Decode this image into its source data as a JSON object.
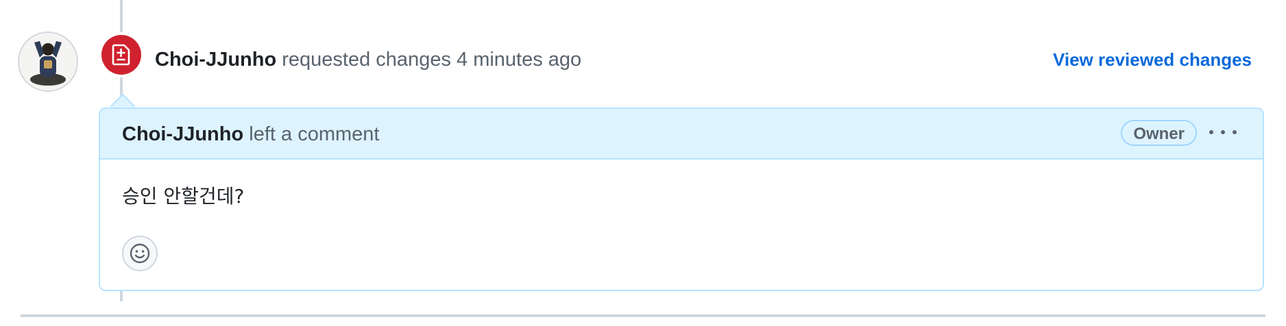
{
  "review_event": {
    "author": "Choi-JJunho",
    "action": "requested changes",
    "time": "4 minutes ago",
    "view_changes_label": "View reviewed changes",
    "badge_icon": "file-diff-icon",
    "badge_color": "#cf222e"
  },
  "comment": {
    "author": "Choi-JJunho",
    "action": "left a comment",
    "role_badge": "Owner",
    "menu_icon": "kebab-horizontal-icon",
    "body": "승인 안할건데?",
    "reaction_icon": "smiley-icon"
  },
  "colors": {
    "link": "#0969da",
    "header_bg": "#ddf4ff",
    "header_border": "#b6e3ff",
    "muted_text": "#59636e"
  }
}
